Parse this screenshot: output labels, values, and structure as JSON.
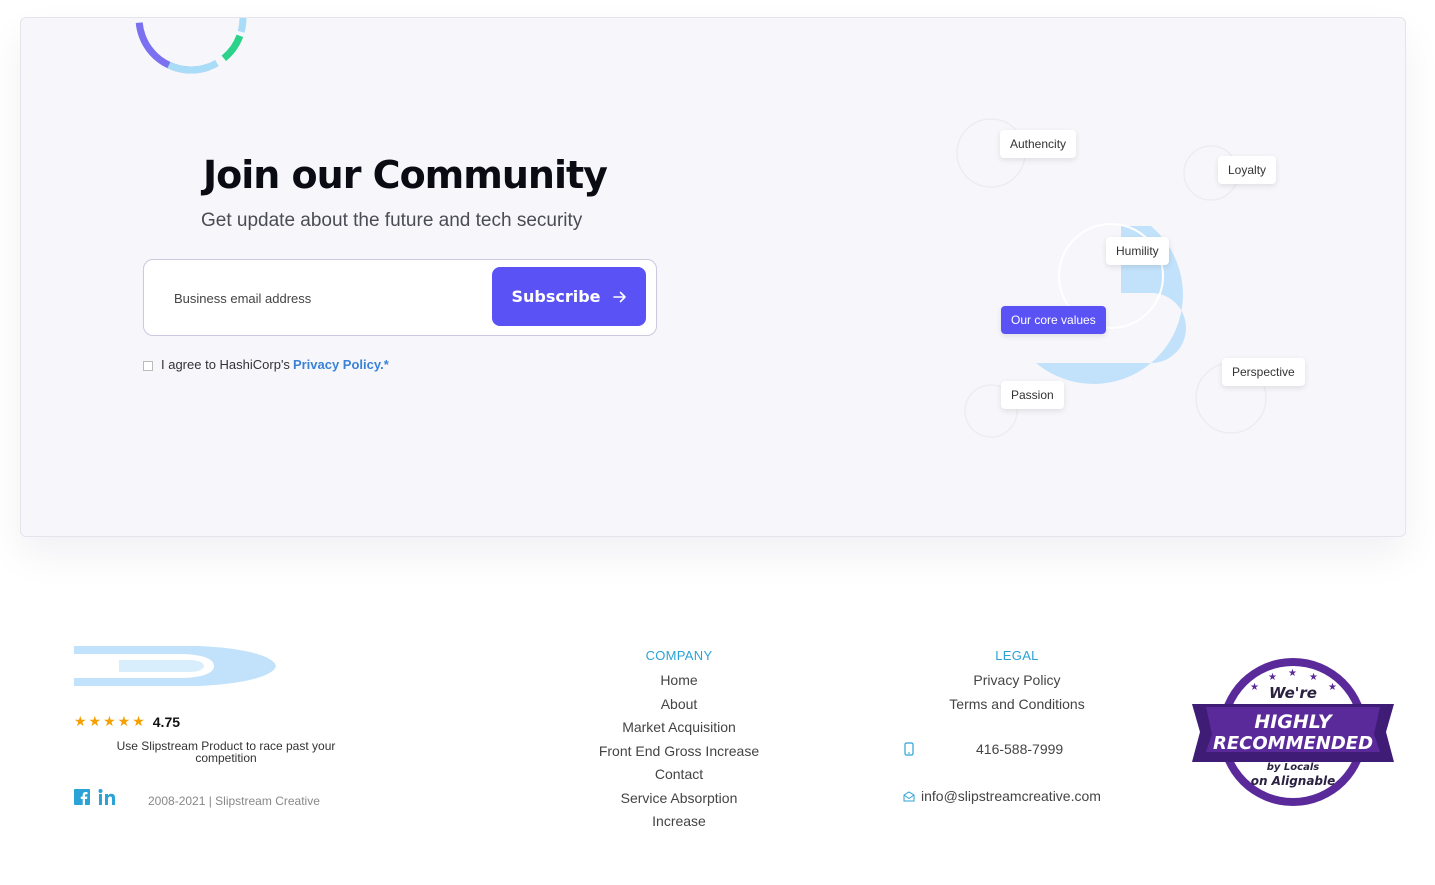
{
  "newsletter": {
    "title": "Join our Community",
    "subtitle": "Get update about the future and tech security",
    "email_placeholder": "Business email address",
    "subscribe_label": "Subscribe",
    "agree_text": "I agree to HashiCorp's",
    "agree_link": "Privacy Policy.*"
  },
  "core_values": {
    "center_label": "Our core values",
    "tags": [
      "Authencity",
      "Loyalty",
      "Humility",
      "Perspective",
      "Passion"
    ]
  },
  "footer": {
    "rating_stars": "★★★★★",
    "rating_value": "4.75",
    "tagline": "Use Slipstream Product to race past your competition",
    "copyright": "2008-2021 |  Slipstream Creative",
    "company": {
      "heading": "COMPANY",
      "links": [
        "Home",
        "About",
        "Market Acquisition",
        "Front End Gross Increase",
        "Contact",
        "Service Absorption",
        "Increase"
      ]
    },
    "legal": {
      "heading": "LEGAL",
      "links": [
        "Privacy Policy",
        "Terms and Conditions"
      ]
    },
    "phone": "416-588-7999",
    "email": "info@slipstreamcreative.com",
    "badge": {
      "line1": "We're",
      "line2": "HIGHLY",
      "line3": "RECOMMENDED",
      "line4": "by Locals",
      "line5": "on Alignable"
    }
  },
  "colors": {
    "accent": "#5b52f5",
    "link_blue": "#2ba3d6",
    "badge_purple": "#5b2a9a",
    "light_blue_art": "#c2e2fb"
  }
}
